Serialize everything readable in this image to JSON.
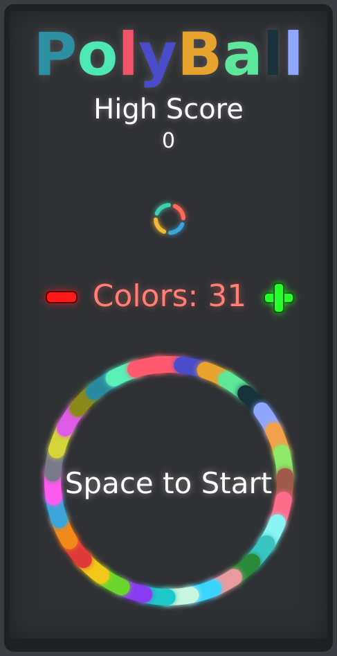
{
  "game": {
    "title_letters": [
      {
        "char": "P",
        "color": "#2c8fa2"
      },
      {
        "char": "o",
        "color": "#4de8b4"
      },
      {
        "char": "l",
        "color": "#f05468"
      },
      {
        "char": "y",
        "color": "#4a4cc9"
      },
      {
        "char": "B",
        "color": "#e8a22e"
      },
      {
        "char": "a",
        "color": "#5ee69a"
      },
      {
        "char": "l",
        "color": "#17323a"
      },
      {
        "char": "l",
        "color": "#8fa6ff"
      }
    ],
    "high_score_label": "High Score",
    "high_score_value": "0",
    "colors_label": "Colors: 31",
    "colors_count": 31,
    "start_prompt": "Space to Start",
    "minus_color": "#ff1a1a",
    "plus_color": "#27ff2c",
    "small_ring_colors": [
      "#ff6b5a",
      "#3aa5d8",
      "#f2b838",
      "#3fcfae"
    ],
    "ring_colors": [
      "#ff5a6e",
      "#4a4cc9",
      "#e8a22e",
      "#5ee69a",
      "#17323a",
      "#8fa6ff",
      "#f2a04a",
      "#8fe86a",
      "#a05a4a",
      "#ff6b8a",
      "#8af5f5",
      "#3ac5c5",
      "#2a8a3a",
      "#e89aa0",
      "#3ad5ff",
      "#c8f5e0",
      "#1ec8c8",
      "#8a3af0",
      "#6ad52a",
      "#f2c81a",
      "#e03a3a",
      "#f28a1a",
      "#3aa5d8",
      "#ff5af0",
      "#7a7a8a",
      "#d5d53a",
      "#e05ae8",
      "#8a8a1a",
      "#2a8aa0",
      "#5af0b8",
      "#ff5a6e"
    ]
  }
}
